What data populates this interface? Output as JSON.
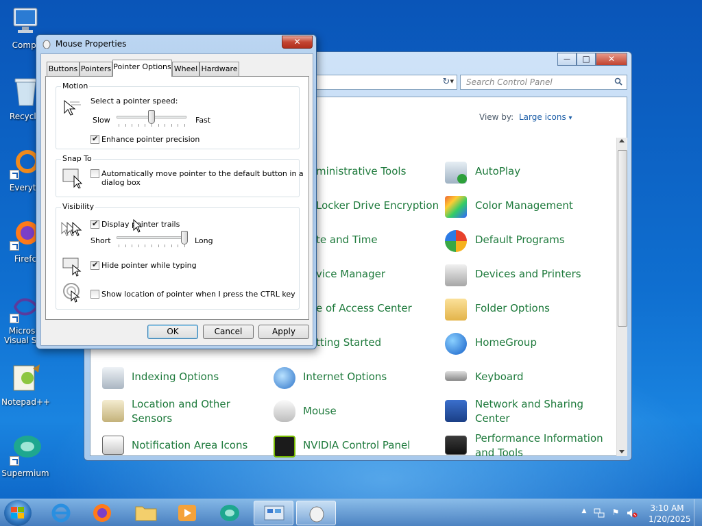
{
  "desktop": {
    "icons": [
      {
        "label": "Compu"
      },
      {
        "label": "Recycle"
      },
      {
        "label": "Everyth"
      },
      {
        "label": "Firefc"
      },
      {
        "label": "Micros Visual St"
      },
      {
        "label": "Notepad++"
      },
      {
        "label": "Supermium"
      }
    ]
  },
  "control_panel": {
    "search_placeholder": "Search Control Panel",
    "view_by_label": "View by:",
    "view_by_value": "Large icons",
    "view_by_caret": "▾",
    "minimize_glyph": "—",
    "maximize_glyph": "□",
    "close_glyph": "✕",
    "addr_caret": "▾",
    "refresh_glyph": "↻",
    "items": [
      {
        "label": "ministrative Tools"
      },
      {
        "label": "AutoPlay"
      },
      {
        "label": "Locker Drive Encryption"
      },
      {
        "label": "Color Management"
      },
      {
        "label": "te and Time"
      },
      {
        "label": "Default Programs"
      },
      {
        "label": "vice Manager"
      },
      {
        "label": "Devices and Printers"
      },
      {
        "label": "e of Access Center"
      },
      {
        "label": "Folder Options"
      },
      {
        "label": "tting Started"
      },
      {
        "label": "HomeGroup"
      },
      {
        "label": "Indexing Options"
      },
      {
        "label": "Internet Options"
      },
      {
        "label": "Keyboard"
      },
      {
        "label": "Location and Other Sensors"
      },
      {
        "label": "Mouse"
      },
      {
        "label": "Network and Sharing Center"
      },
      {
        "label": "Notification Area Icons"
      },
      {
        "label": "NVIDIA Control Panel"
      },
      {
        "label": "Performance Information and Tools"
      }
    ]
  },
  "dialog": {
    "title": "Mouse Properties",
    "close_glyph": "✕",
    "tabs": [
      "Buttons",
      "Pointers",
      "Pointer Options",
      "Wheel",
      "Hardware"
    ],
    "selected_tab": "Pointer Options",
    "motion": {
      "group_label": "Motion",
      "speed_label": "Select a pointer speed:",
      "slow_label": "Slow",
      "fast_label": "Fast",
      "speed_level": 0.5,
      "enhance_label": "Enhance pointer precision",
      "enhance_checked": true
    },
    "snap_to": {
      "group_label": "Snap To",
      "auto_label_line1": "Automatically move pointer to the default button in a",
      "auto_label_line2": "dialog box",
      "auto_checked": false
    },
    "visibility": {
      "group_label": "Visibility",
      "trails_label": "Display pointer trails",
      "trails_checked": true,
      "short_label": "Short",
      "long_label": "Long",
      "trail_level": 1.0,
      "hide_label": "Hide pointer while typing",
      "hide_checked": true,
      "ctrl_label": "Show location of pointer when I press the CTRL key",
      "ctrl_checked": false
    },
    "buttons": {
      "ok": "OK",
      "cancel": "Cancel",
      "apply": "Apply"
    }
  },
  "taskbar": {
    "time": "3:10 AM",
    "date": "1/20/2025",
    "tray_up_glyph": "▲",
    "tray_flag_glyph": "⚑"
  }
}
